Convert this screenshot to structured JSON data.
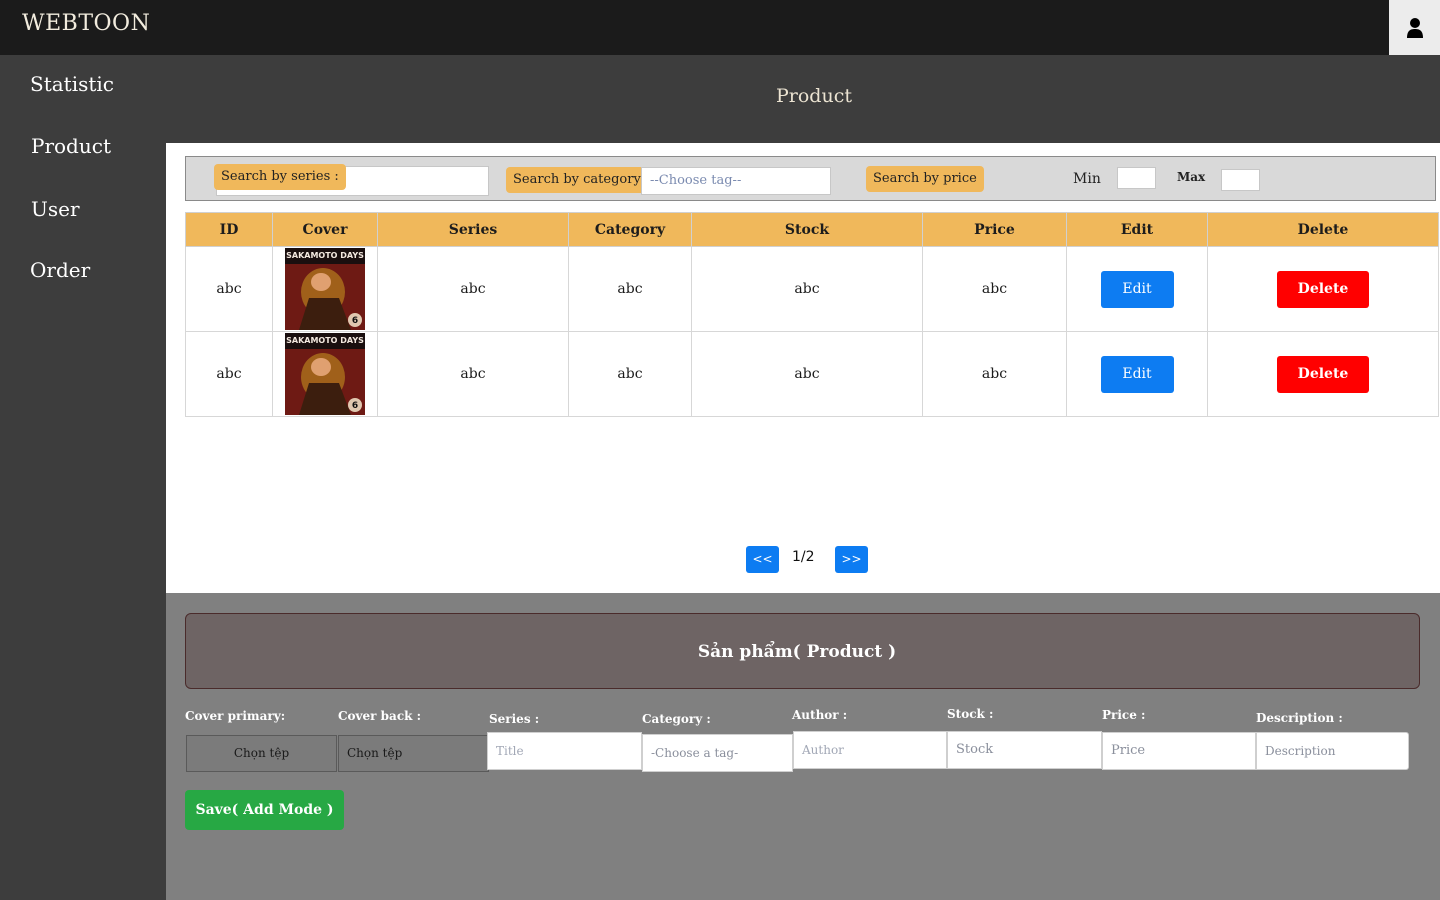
{
  "app": {
    "brand": "WEBTOON"
  },
  "header": {
    "user_icon": "user-icon"
  },
  "sidebar": {
    "items": [
      {
        "label": "Statistic"
      },
      {
        "label": "Product"
      },
      {
        "label": "User"
      },
      {
        "label": "Order"
      }
    ]
  },
  "main": {
    "title": "Product"
  },
  "search": {
    "series_label": "Search by series :",
    "series_value": "",
    "category_label": "Search by category :",
    "category_placeholder": "--Choose tag--",
    "price_label": "Search by price",
    "min_label": "Min",
    "max_label": "Max"
  },
  "table": {
    "headers": [
      "ID",
      "Cover",
      "Series",
      "Category",
      "Stock",
      "Price",
      "Edit",
      "Delete"
    ],
    "rows": [
      {
        "id": "abc",
        "cover_title": "SAKAMOTO DAYS",
        "cover_volume": "6",
        "series": "abc",
        "category": "abc",
        "stock": "abc",
        "price": "abc",
        "edit": "Edit",
        "delete": "Delete"
      },
      {
        "id": "abc",
        "cover_title": "SAKAMOTO DAYS",
        "cover_volume": "6",
        "series": "abc",
        "category": "abc",
        "stock": "abc",
        "price": "abc",
        "edit": "Edit",
        "delete": "Delete"
      }
    ]
  },
  "pagination": {
    "prev": "<<",
    "page": "1/2",
    "next": ">>"
  },
  "form": {
    "title": "Sản phẩm( Product )",
    "labels": {
      "cover_primary": "Cover primary:",
      "cover_back": "Cover back :",
      "series": "Series :",
      "category": "Category :",
      "author": "Author :",
      "stock": "Stock :",
      "price": "Price :",
      "description": "Description :"
    },
    "file_button": "Chọn tệp",
    "placeholders": {
      "title": "Title",
      "category": "-Choose a tag-",
      "author": "Author",
      "stock": "Stock",
      "price": "Price",
      "description": "Description"
    },
    "save": "Save( Add Mode )"
  },
  "colors": {
    "topbar": "#1b1b1b",
    "sidebar": "#3d3d3d",
    "accent_orange": "#f0b85b",
    "edit_blue": "#0d7cf2",
    "delete_red": "#ff0000",
    "save_green": "#27a844",
    "form_bg": "#808080"
  }
}
